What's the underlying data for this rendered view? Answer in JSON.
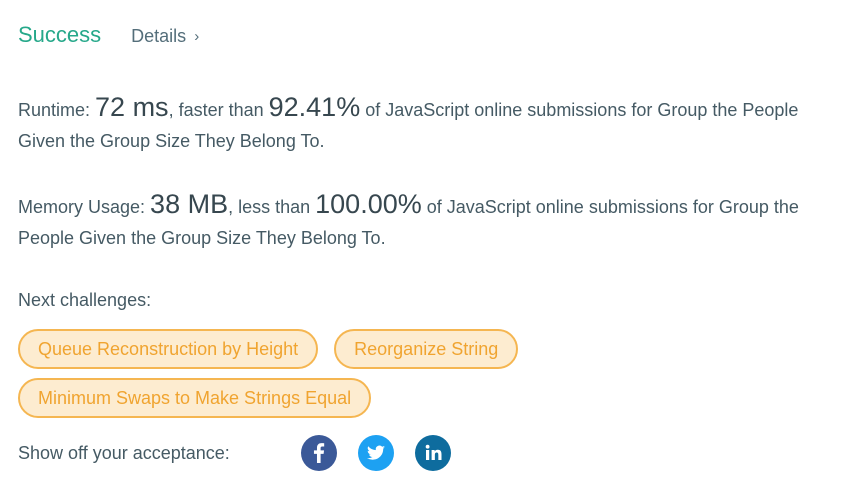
{
  "status": {
    "label": "Success",
    "details_label": "Details",
    "details_chevron": "›"
  },
  "runtime": {
    "label": "Runtime: ",
    "value": "72 ms",
    "mid_text": ", faster than ",
    "percent": "92.41%",
    "suffix": " of JavaScript online submissions for Group the People Given the Group Size They Belong To."
  },
  "memory": {
    "label": "Memory Usage: ",
    "value": "38 MB",
    "mid_text": ", less than ",
    "percent": "100.00%",
    "suffix": " of JavaScript online submissions for Group the People Given the Group Size They Belong To."
  },
  "next_challenges": {
    "label": "Next challenges:",
    "items": [
      "Queue Reconstruction by Height",
      "Reorganize String",
      "Minimum Swaps to Make Strings Equal"
    ]
  },
  "share": {
    "label": "Show off your acceptance:",
    "icons": [
      "facebook-icon",
      "twitter-icon",
      "linkedin-icon"
    ]
  },
  "colors": {
    "success": "#26a88a",
    "tag_border": "#f5b651",
    "tag_bg": "#fdecd0",
    "tag_text": "#f0a430",
    "facebook": "#3b5998",
    "twitter": "#1da1f2",
    "linkedin": "#0e6c9e"
  }
}
